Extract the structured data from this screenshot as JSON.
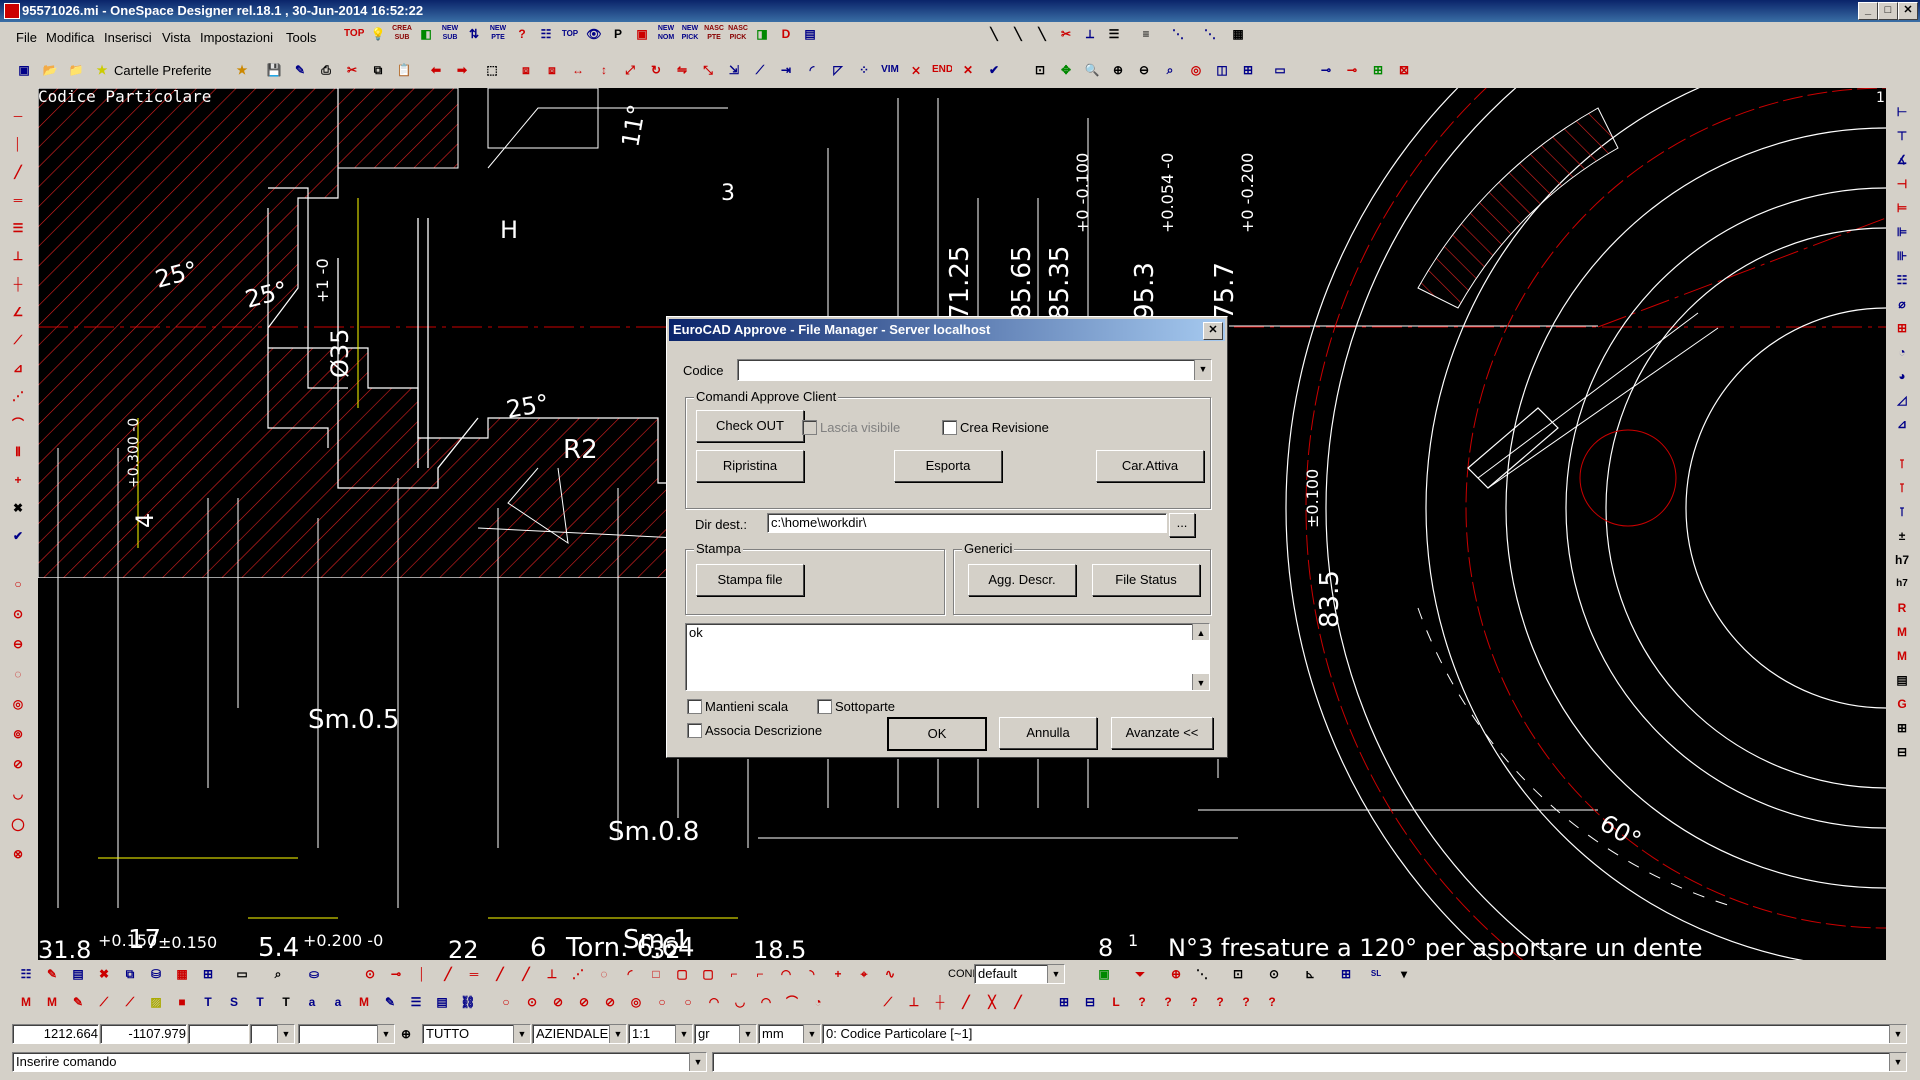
{
  "window": {
    "title": "95571026.mi - OneSpace Designer rel.18.1 , 30-Jun-2014 16:52:22",
    "controls": [
      "_",
      "□",
      "✕"
    ]
  },
  "menubar": {
    "items": [
      "File",
      "Modifica",
      "Inserisci",
      "Vista",
      "Impostazioni",
      "Tools"
    ]
  },
  "toolbar_top": {
    "favorites_label": "Cartelle Preferite",
    "icons": [
      "TOP",
      "CREA SUB",
      "NEW SUB",
      "NEW PTE",
      "TOP",
      "NEW NOM",
      "NEW PICK",
      "NASC PTE",
      "NASC PICK",
      "VIM",
      "END"
    ]
  },
  "canvas": {
    "part_label": "Codice Particolare",
    "corner_number": "1",
    "annotations": {
      "a11": "11°",
      "a3": "3",
      "h": "H",
      "d71": "71.25",
      "d85": "85.65",
      "d85b": "85.35",
      "d85b_tol": "+0 -0.100",
      "d95": "95.3",
      "d95_tol": "+0.054 -0",
      "d75": "75.7",
      "d75_tol": "+0 -0.200",
      "a25a": "25°",
      "a25b": "25°",
      "a25c": "25°",
      "dia35": "Ø35",
      "dia35_tol": "+1 -0",
      "r2": "R2",
      "d4": "4",
      "d4_tol": "+0.300 -0",
      "sm05": "Sm.0.5",
      "sm08": "Sm.0.8",
      "sm1": "Sm.1",
      "d17": "17",
      "d17_tol": "±0.150",
      "d54": "5.4",
      "d54_tol": "+0.200 -0",
      "d6": "6",
      "torn": "Torn. 6.64",
      "d318": "31.8",
      "d318_tol": "+0.150",
      "d835": "83.5",
      "d835_tol": "±0.100",
      "a60": "60°",
      "bottom_note": "N°3 fresature a 120° per asportare un dente",
      "bottom_8": "8",
      "bottom_1": "1",
      "bottom_22": "22",
      "bottom_32": "32",
      "bottom_185": "18.5"
    }
  },
  "dialog": {
    "title": "EuroCAD Approve - File Manager - Server localhost",
    "codice_label": "Codice",
    "codice_value": "",
    "group_client": "Comandi Approve Client",
    "checkout": "Check OUT",
    "lascia_visibile": "Lascia visibile",
    "crea_revisione": "Crea Revisione",
    "ripristina": "Ripristina",
    "esporta": "Esporta",
    "car_attiva": "Car.Attiva",
    "dirdest_label": "Dir dest.:",
    "dirdest_value": "c:\\home\\workdir\\",
    "browse": "...",
    "group_stampa": "Stampa",
    "stampa_file": "Stampa file",
    "group_generici": "Generici",
    "agg_descr": "Agg. Descr.",
    "file_status": "File Status",
    "log_text": "ok",
    "mantieni_scala": "Mantieni scala",
    "sottoparte": "Sottoparte",
    "associa_descrizione": "Associa Descrizione",
    "ok": "OK",
    "annulla": "Annulla",
    "avanzate": "Avanzate <<"
  },
  "bottom_toolbar": {
    "conf_label": "CONF",
    "conf_value": "default"
  },
  "statusbar": {
    "x": "1212.664",
    "y": "-1107.979",
    "layer": "TUTTO",
    "company": "AZIENDALE",
    "scale": "1:1",
    "angle_unit": "gr",
    "length_unit": "mm",
    "part": "0: Codice Particolare [~1]",
    "command_label": "Inserire comando"
  }
}
